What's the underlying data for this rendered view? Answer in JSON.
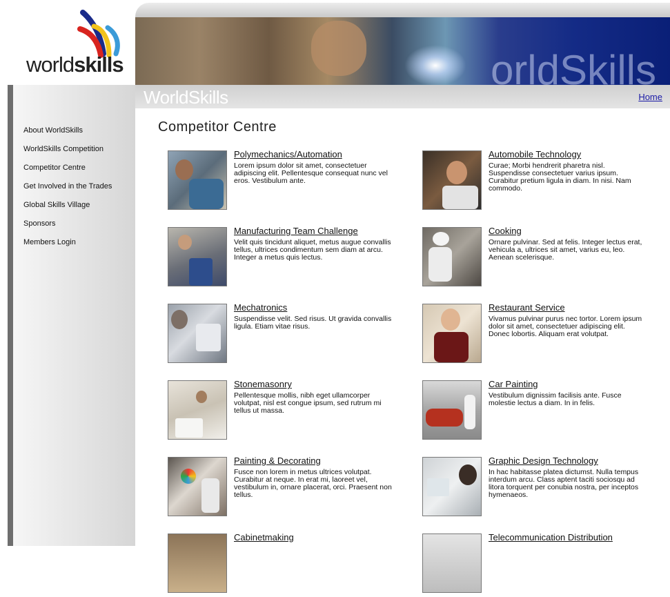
{
  "logo": {
    "text_light": "world",
    "text_bold": "skills"
  },
  "banner": {
    "watermark": "orldSkills"
  },
  "subbanner": {
    "title": "WorldSkills",
    "home_link": "Home"
  },
  "sidebar": {
    "items": [
      {
        "label": "About WorldSkills"
      },
      {
        "label": "WorldSkills Competition"
      },
      {
        "label": "Competitor Centre"
      },
      {
        "label": "Get Involved in the Trades"
      },
      {
        "label": "Global Skills Village"
      },
      {
        "label": "Sponsors"
      },
      {
        "label": "Members Login"
      }
    ]
  },
  "main": {
    "title": "Competitor Centre",
    "items": [
      {
        "title": "Polymechanics/Automation",
        "desc": "Lorem ipsum dolor sit amet, consectetuer adipiscing elit. Pellentesque consequat nunc vel eros. Vestibulum ante."
      },
      {
        "title": "Automobile Technology",
        "desc": "Curae; Morbi hendrerit pharetra nisl. Suspendisse consectetuer varius ipsum. Curabitur pretium ligula in diam. In nisi. Nam commodo."
      },
      {
        "title": "Manufacturing Team Challenge",
        "desc": "Velit quis tincidunt aliquet, metus augue convallis tellus, ultrices condimentum sem diam at arcu. Integer a metus quis lectus."
      },
      {
        "title": "Cooking",
        "desc": "Ornare pulvinar. Sed at felis. Integer lectus erat, vehicula a, ultrices sit amet, varius eu, leo. Aenean scelerisque."
      },
      {
        "title": "Mechatronics",
        "desc": "Suspendisse velit. Sed risus. Ut gravida convallis ligula. Etiam vitae risus."
      },
      {
        "title": "Restaurant Service",
        "desc": "Vivamus pulvinar purus nec tortor. Lorem ipsum dolor sit amet, consectetuer adipiscing elit. Donec lobortis. Aliquam erat volutpat."
      },
      {
        "title": "Stonemasonry",
        "desc": "Pellentesque mollis, nibh eget ullamcorper volutpat, nisl est congue ipsum, sed rutrum mi tellus ut massa."
      },
      {
        "title": "Car Painting",
        "desc": "Vestibulum dignissim facilisis ante. Fusce molestie lectus a diam. In in felis."
      },
      {
        "title": "Painting & Decorating",
        "desc": "Fusce non lorem in metus ultrices volutpat. Curabitur at neque. In erat mi, laoreet vel, vestibulum in, ornare placerat, orci. Praesent non tellus."
      },
      {
        "title": "Graphic Design Technology",
        "desc": "In hac habitasse platea dictumst. Nulla tempus interdum arcu. Class aptent taciti sociosqu ad litora torquent per conubia nostra, per inceptos hymenaeos."
      },
      {
        "title": "Cabinetmaking",
        "desc": ""
      },
      {
        "title": "Telecommunication Distribution",
        "desc": ""
      }
    ]
  },
  "colors": {
    "link": "#1a1aa6",
    "sidebar_bar": "#6e6e6e",
    "banner_blue": "#0a1f77"
  }
}
